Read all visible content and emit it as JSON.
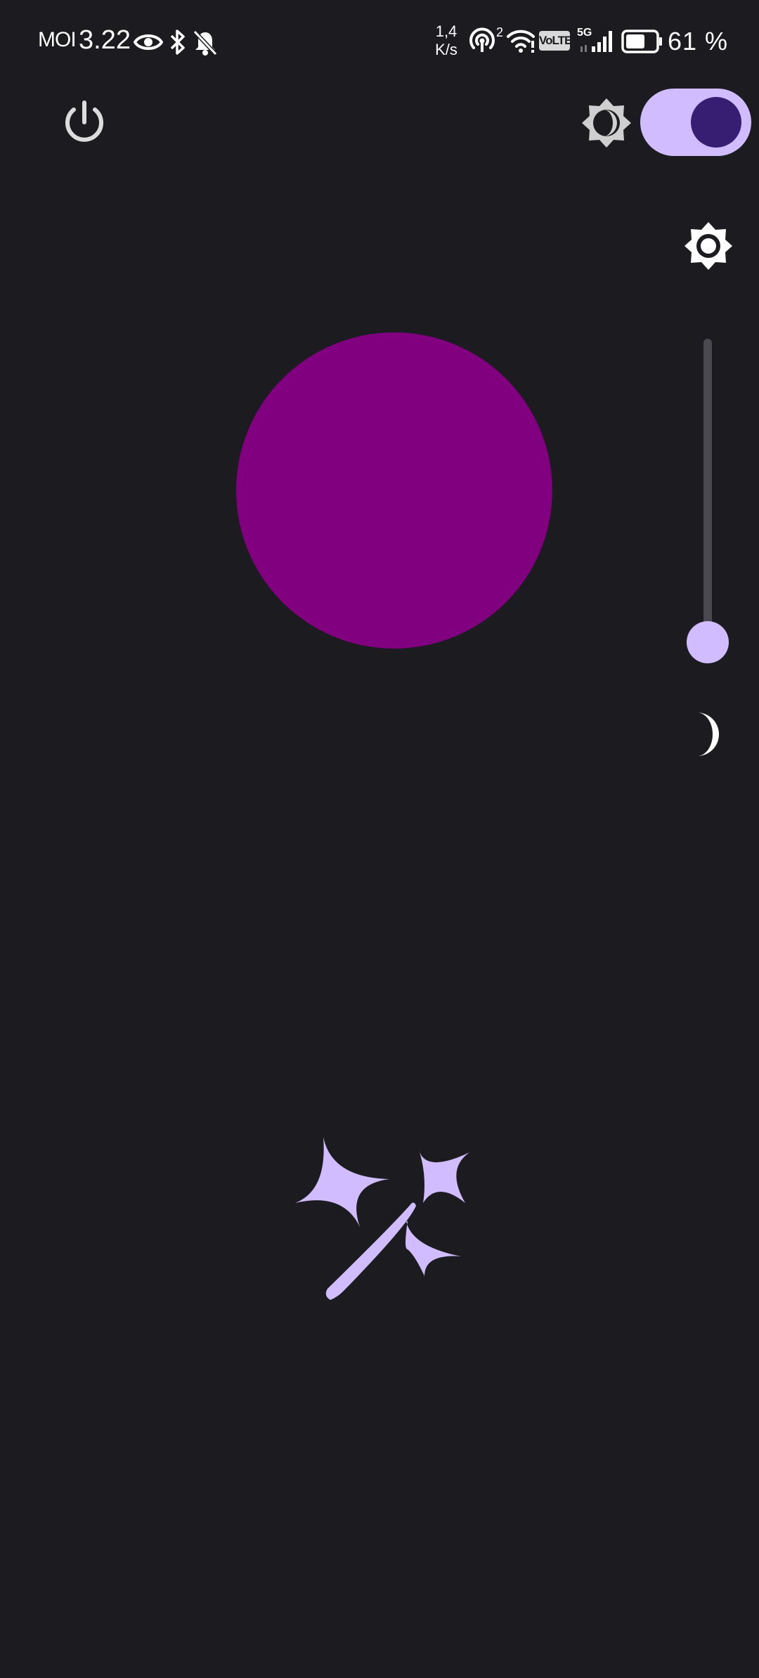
{
  "status_bar": {
    "carrier": "MOI",
    "time": "3.22",
    "net_speed_value": "1,4",
    "net_speed_unit": "K/s",
    "hotspot_count": "2",
    "volte": "VoLTE",
    "network": "5G",
    "battery_percent": "61 %",
    "icons": [
      "eye-icon",
      "bluetooth-icon",
      "bell-off-icon",
      "hotspot-icon",
      "wifi-icon",
      "volte-icon",
      "signal-icon",
      "battery-icon"
    ]
  },
  "controls": {
    "power": {
      "icon": "power-icon"
    },
    "theme_toggle": {
      "icon": "theme-auto-icon",
      "state": "on"
    },
    "brightness": {
      "high_icon": "brightness-icon",
      "low_icon": "moon-icon",
      "level": 0
    },
    "color": {
      "hex": "#800080"
    },
    "effects": {
      "icon": "magic-wand-icon"
    }
  },
  "colors": {
    "background": "#1c1b20",
    "accent": "#d0bcff",
    "accent_dark": "#381e72",
    "selected_color": "#800080",
    "track": "#4a4950"
  }
}
